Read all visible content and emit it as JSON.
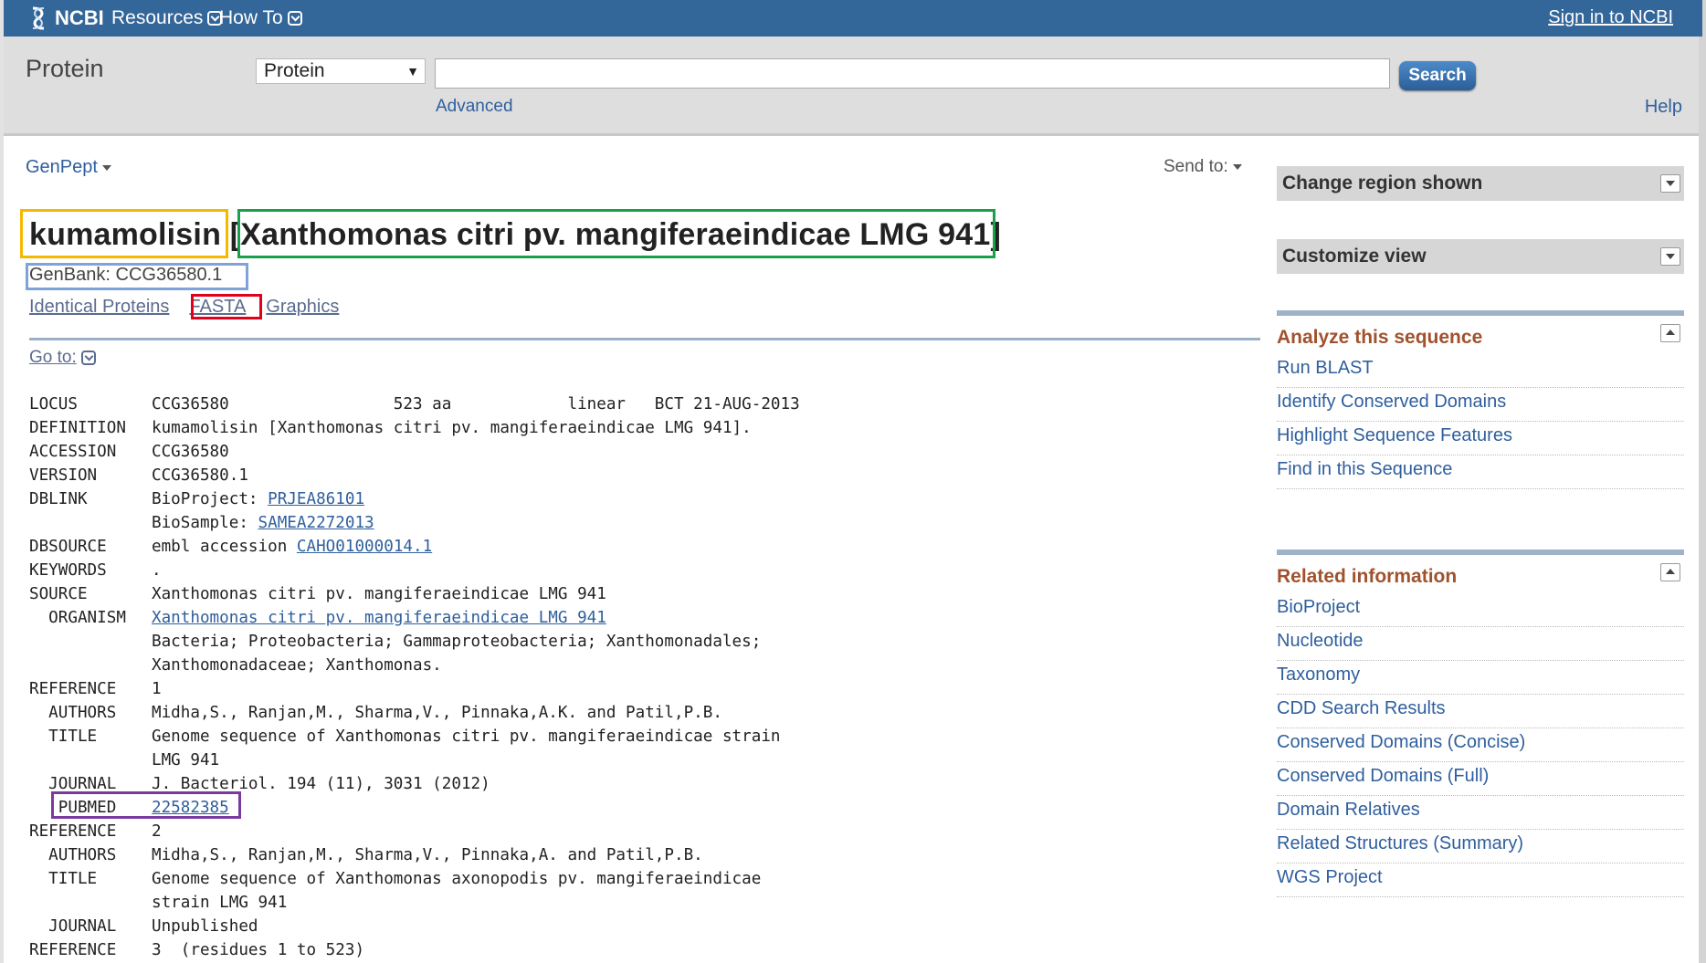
{
  "header": {
    "logo_text": "NCBI",
    "nav": [
      {
        "label": "Resources"
      },
      {
        "label": "How To"
      }
    ],
    "sign_in": "Sign in to NCBI"
  },
  "search": {
    "db_title": "Protein",
    "db_selected": "Protein",
    "query": "",
    "button": "Search",
    "advanced": "Advanced",
    "help": "Help"
  },
  "record": {
    "format": "GenPept",
    "send_to": "Send to:",
    "title_protein": "kumamolisin",
    "title_organism": "[Xanthomonas citri pv. mangiferaeindicae LMG 941]",
    "accession": "GenBank: CCG36580.1",
    "links": [
      "Identical Proteins",
      "FASTA",
      "Graphics"
    ],
    "goto": "Go to:"
  },
  "flatfile": [
    {
      "key": "LOCUS",
      "val": "CCG36580                 523 aa            linear   BCT 21-AUG-2013"
    },
    {
      "key": "DEFINITION",
      "val": "kumamolisin [Xanthomonas citri pv. mangiferaeindicae LMG 941]."
    },
    {
      "key": "ACCESSION",
      "val": "CCG36580"
    },
    {
      "key": "VERSION",
      "val": "CCG36580.1"
    },
    {
      "key": "DBLINK",
      "val": "BioProject: ",
      "link": "PRJEA86101"
    },
    {
      "key": "",
      "val": "BioSample: ",
      "link": "SAMEA2272013"
    },
    {
      "key": "DBSOURCE",
      "val": "embl accession ",
      "link": "CAHO01000014.1"
    },
    {
      "key": "KEYWORDS",
      "val": "."
    },
    {
      "key": "SOURCE",
      "val": "Xanthomonas citri pv. mangiferaeindicae LMG 941"
    },
    {
      "key": "  ORGANISM",
      "val": "",
      "link": "Xanthomonas citri pv. mangiferaeindicae LMG 941"
    },
    {
      "key": "",
      "val": "Bacteria; Proteobacteria; Gammaproteobacteria; Xanthomonadales;"
    },
    {
      "key": "",
      "val": "Xanthomonadaceae; Xanthomonas."
    },
    {
      "key": "REFERENCE",
      "val": "1"
    },
    {
      "key": "  AUTHORS",
      "val": "Midha,S., Ranjan,M., Sharma,V., Pinnaka,A.K. and Patil,P.B."
    },
    {
      "key": "  TITLE",
      "val": "Genome sequence of Xanthomonas citri pv. mangiferaeindicae strain"
    },
    {
      "key": "",
      "val": "LMG 941"
    },
    {
      "key": "  JOURNAL",
      "val": "J. Bacteriol. 194 (11), 3031 (2012)"
    },
    {
      "key": "   PUBMED",
      "val": "",
      "link": "22582385"
    },
    {
      "key": "REFERENCE",
      "val": "2"
    },
    {
      "key": "  AUTHORS",
      "val": "Midha,S., Ranjan,M., Sharma,V., Pinnaka,A. and Patil,P.B."
    },
    {
      "key": "  TITLE",
      "val": "Genome sequence of Xanthomonas axonopodis pv. mangiferaeindicae"
    },
    {
      "key": "",
      "val": "strain LMG 941"
    },
    {
      "key": "  JOURNAL",
      "val": "Unpublished"
    },
    {
      "key": "REFERENCE",
      "val": "3  (residues 1 to 523)"
    }
  ],
  "sidebar": {
    "change_region": "Change region shown",
    "customize_view": "Customize view",
    "analyze_title": "Analyze this sequence",
    "analyze_items": [
      "Run BLAST",
      "Identify Conserved Domains",
      "Highlight Sequence Features",
      "Find in this Sequence"
    ],
    "related_title": "Related information",
    "related_items": [
      "BioProject",
      "Nucleotide",
      "Taxonomy",
      "CDD Search Results",
      "Conserved Domains (Concise)",
      "Conserved Domains (Full)",
      "Domain Relatives",
      "Related Structures (Summary)",
      "WGS Project"
    ]
  },
  "colors": {
    "header_bg": "#336699",
    "link": "#2f5f9e",
    "section_title": "#a0522d",
    "highlight_yellow": "#f5b800",
    "highlight_green": "#1aa04a",
    "highlight_blue": "#7fa3d8",
    "highlight_red": "#e3001b",
    "highlight_purple": "#7a3aa0"
  }
}
